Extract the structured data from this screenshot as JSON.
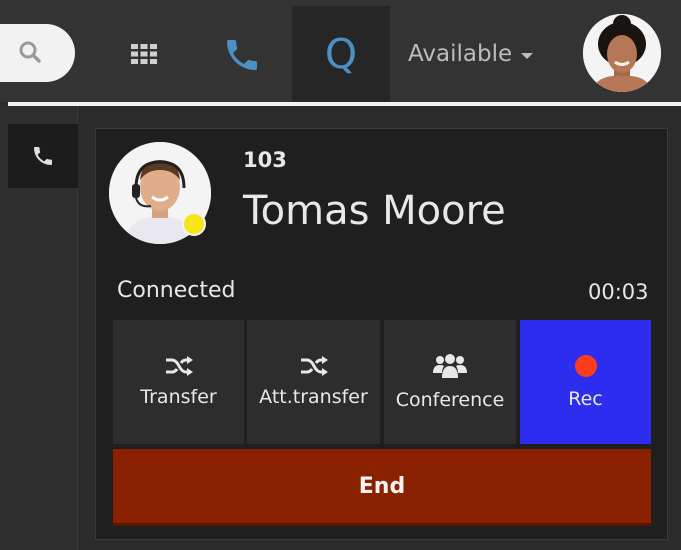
{
  "topbar": {
    "queue_tab_label": "Q",
    "status": "Available"
  },
  "call": {
    "extension": "103",
    "contact_name": "Tomas Moore",
    "state": "Connected",
    "timer": "00:03",
    "actions": [
      {
        "label": "Transfer",
        "icon": "shuffle-icon"
      },
      {
        "label": "Att.transfer",
        "icon": "shuffle-icon"
      },
      {
        "label": "Conference",
        "icon": "group-icon"
      },
      {
        "label": "Rec",
        "icon": "record-icon"
      }
    ],
    "end_label": "End"
  },
  "colors": {
    "accent_blue": "#4a90c2",
    "record_active": "#2d2df0",
    "record_dot": "#ff3b1e",
    "end_button": "#8a2100",
    "presence_away": "#f7e51b"
  }
}
